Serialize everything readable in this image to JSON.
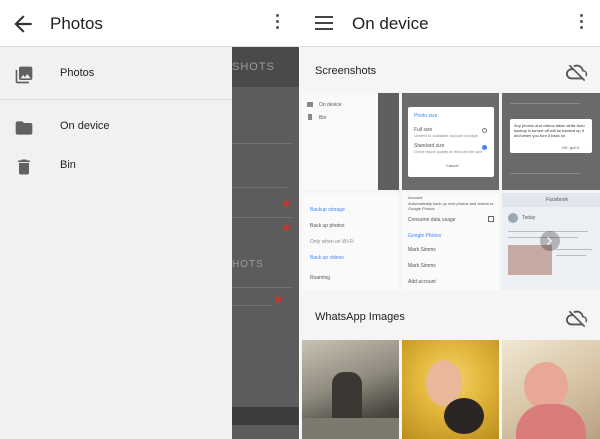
{
  "left_panel": {
    "title": "Photos",
    "back_icon": "arrow-back-icon",
    "more_icon": "more-vert-icon",
    "drawer_items": [
      {
        "label": "Photos",
        "icon": "photo-library-icon"
      },
      {
        "label": "On device",
        "icon": "folder-icon"
      },
      {
        "label": "Bin",
        "icon": "trash-icon"
      }
    ],
    "background_screen_text": [
      "SHOTS",
      "HOTS"
    ]
  },
  "right_panel": {
    "title": "On device",
    "menu_icon": "hamburger-menu-icon",
    "more_icon": "more-vert-icon",
    "sections": [
      {
        "name": "Screenshots",
        "cloud_icon": "cloud-off-icon"
      },
      {
        "name": "WhatsApp Images",
        "cloud_icon": "cloud-off-icon"
      }
    ],
    "screenshot_thumb_text": {
      "t1": [
        "On device",
        "Bin"
      ],
      "t2": {
        "dialog_title": "Photo size",
        "option1": "Full size",
        "option1_sub": "Limited to available account storage",
        "option2": "Standard size",
        "option2_sub": "Great visual quality at reduced file size",
        "action": "Cancel"
      },
      "t3": {
        "message": "Any photos and videos taken while Auto backup is turned off will be backed up if and when you turn it back on.",
        "ok": "OK, got it"
      },
      "t4": [
        "Backup storage",
        "Back up photos",
        "Only when on Wi-Fi",
        "Back up videos",
        "Roaming"
      ],
      "t5": [
        "Account",
        "Automatically back up new photos and videos to Google Photos",
        "Consume data usage",
        "Google Photos",
        "Mark Simms",
        "Add account"
      ],
      "t6": [
        "Facebook",
        "Today"
      ]
    },
    "colors": {
      "accent": "#4285f4"
    }
  }
}
